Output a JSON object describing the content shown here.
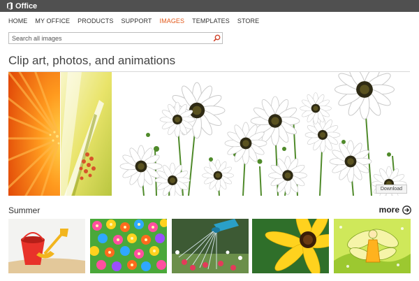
{
  "brand": {
    "name": "Office"
  },
  "nav": {
    "items": [
      {
        "label": "HOME"
      },
      {
        "label": "MY OFFICE"
      },
      {
        "label": "PRODUCTS"
      },
      {
        "label": "SUPPORT"
      },
      {
        "label": "IMAGES"
      },
      {
        "label": "TEMPLATES"
      },
      {
        "label": "STORE"
      }
    ],
    "active": "IMAGES"
  },
  "search": {
    "placeholder": "Search all images",
    "value": "",
    "icon": "search-icon"
  },
  "section_title": "Clip art, photos, and animations",
  "hero": {
    "download_label": "Download"
  },
  "summer": {
    "title": "Summer",
    "more_label": "more"
  },
  "colors": {
    "accent": "#e25a1c",
    "topbar": "#505050"
  }
}
